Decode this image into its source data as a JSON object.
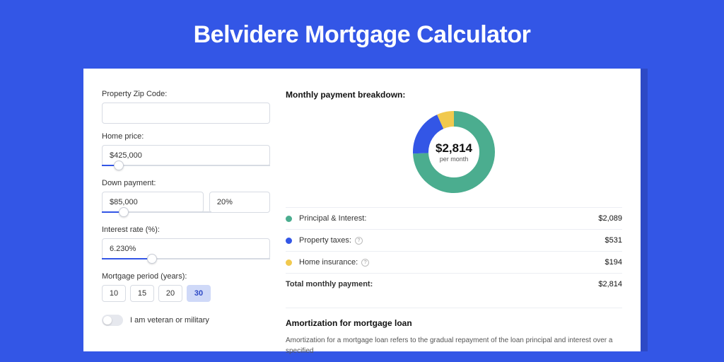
{
  "title": "Belvidere Mortgage Calculator",
  "form": {
    "zip": {
      "label": "Property Zip Code:",
      "value": ""
    },
    "homePrice": {
      "label": "Home price:",
      "value": "$425,000",
      "sliderPct": 10
    },
    "downPayment": {
      "label": "Down payment:",
      "amount": "$85,000",
      "pct": "20%",
      "sliderPct": 20
    },
    "interest": {
      "label": "Interest rate (%):",
      "value": "6.230%",
      "sliderPct": 30
    },
    "period": {
      "label": "Mortgage period (years):",
      "options": [
        "10",
        "15",
        "20",
        "30"
      ],
      "active": "30"
    },
    "veteran": {
      "label": "I am veteran or military",
      "on": false
    }
  },
  "breakdown": {
    "title": "Monthly payment breakdown:",
    "donut": {
      "value": "$2,814",
      "sub": "per month"
    },
    "items": [
      {
        "label": "Principal & Interest:",
        "value": "$2,089",
        "color": "#4bad8f",
        "info": false
      },
      {
        "label": "Property taxes:",
        "value": "$531",
        "color": "#3356e6",
        "info": true
      },
      {
        "label": "Home insurance:",
        "value": "$194",
        "color": "#f1c94e",
        "info": true
      }
    ],
    "total": {
      "label": "Total monthly payment:",
      "value": "$2,814"
    }
  },
  "chart_data": {
    "type": "pie",
    "title": "Monthly payment breakdown",
    "series": [
      {
        "name": "Principal & Interest",
        "value": 2089,
        "color": "#4bad8f"
      },
      {
        "name": "Property taxes",
        "value": 531,
        "color": "#3356e6"
      },
      {
        "name": "Home insurance",
        "value": 194,
        "color": "#f1c94e"
      }
    ],
    "total": 2814,
    "center_label": "$2,814 per month"
  },
  "amortization": {
    "title": "Amortization for mortgage loan",
    "text": "Amortization for a mortgage loan refers to the gradual repayment of the loan principal and interest over a specified"
  }
}
